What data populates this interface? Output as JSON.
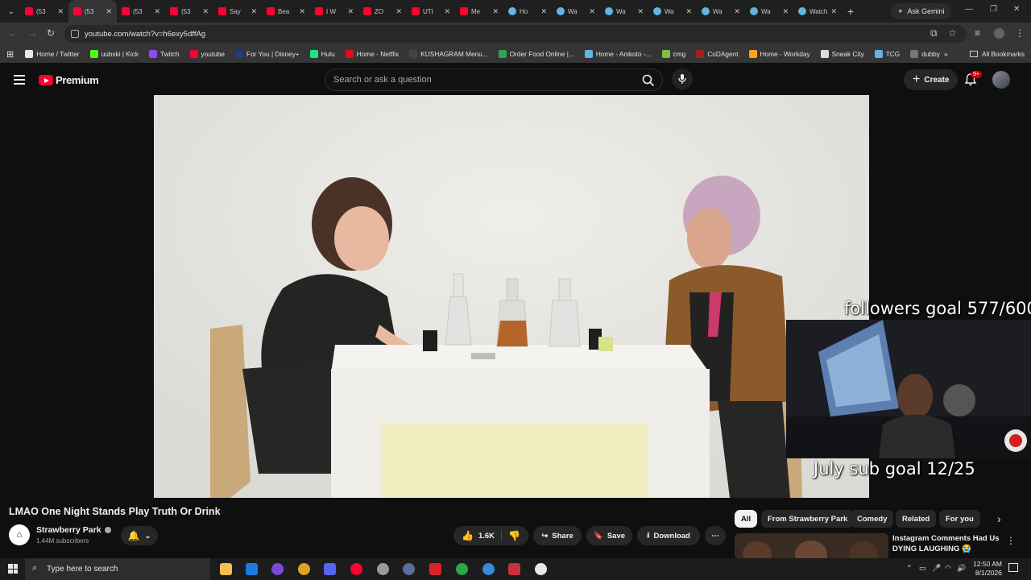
{
  "browser": {
    "tabs": [
      {
        "label": "(53",
        "icon": "youtube-icon"
      },
      {
        "label": "(53",
        "icon": "youtube-icon",
        "active": true
      },
      {
        "label": "(53",
        "icon": "youtube-icon"
      },
      {
        "label": "(53",
        "icon": "youtube-icon"
      },
      {
        "label": "Say",
        "icon": "youtube-icon"
      },
      {
        "label": "Bea",
        "icon": "youtube-icon"
      },
      {
        "label": "I W",
        "icon": "youtube-icon"
      },
      {
        "label": "ZO",
        "icon": "youtube-icon"
      },
      {
        "label": "UTI",
        "icon": "youtube-icon"
      },
      {
        "label": "Me",
        "icon": "youtube-icon"
      },
      {
        "label": "Ho",
        "icon": "globe-icon"
      },
      {
        "label": "Wa",
        "icon": "globe-icon"
      },
      {
        "label": "Wa",
        "icon": "globe-icon"
      },
      {
        "label": "Wa",
        "icon": "globe-icon"
      },
      {
        "label": "Wa",
        "icon": "globe-icon"
      },
      {
        "label": "Wa",
        "icon": "globe-icon"
      },
      {
        "label": "Watch",
        "icon": "globe-icon"
      }
    ],
    "gemini_label": "Ask Gemini",
    "url": "youtube.com/watch?v=h6exy5dffAg",
    "bookmarks": [
      {
        "label": "Home / Twitter",
        "color": "#e7e9ea"
      },
      {
        "label": "uubski | Kick",
        "color": "#53fc18"
      },
      {
        "label": "Twitch",
        "color": "#9146ff"
      },
      {
        "label": "youtube",
        "color": "#ff0033"
      },
      {
        "label": "For You | Disney+",
        "color": "#1f3b8a"
      },
      {
        "label": "Hulu",
        "color": "#1ce783"
      },
      {
        "label": "Home - Netflix",
        "color": "#e50914"
      },
      {
        "label": "KUSHAGRAM Menu...",
        "color": "#444444"
      },
      {
        "label": "Order Food Online |...",
        "color": "#2aa84a"
      },
      {
        "label": "Home - Anikoto -...",
        "color": "#5fb6e0"
      },
      {
        "label": "cmg",
        "color": "#7ac143"
      },
      {
        "label": "CoDAgent",
        "color": "#a32020"
      },
      {
        "label": "Home - Workday",
        "color": "#f5a623"
      },
      {
        "label": "Sneak City",
        "color": "#dddddd"
      },
      {
        "label": "TCG",
        "color": "#5fb6e0"
      },
      {
        "label": "dubby",
        "color": "#777777"
      }
    ],
    "all_bookmarks_label": "All Bookmarks"
  },
  "youtube": {
    "logo_label": "Premium",
    "search_placeholder": "Search or ask a question",
    "create_label": "Create",
    "notification_badge": "9+"
  },
  "stream_overlay": {
    "followers_goal": "followers goal 577/600",
    "sub_goal": "July sub goal 12/25"
  },
  "video": {
    "title": "LMAO One Night Stands Play Truth Or Drink",
    "channel": "Strawberry Park",
    "subscribers": "1.44M subscribers",
    "likes": "1.6K",
    "share_label": "Share",
    "save_label": "Save",
    "download_label": "Download"
  },
  "sidebar": {
    "chips": [
      "All",
      "From Strawberry Park",
      "Comedy",
      "Related",
      "For you"
    ],
    "recommendation_title": "Instagram Comments Had Us DYING LAUGHING 😭"
  },
  "taskbar": {
    "search_placeholder": "Type here to search",
    "time": "12:50 AM",
    "date": "8/1/2026"
  }
}
